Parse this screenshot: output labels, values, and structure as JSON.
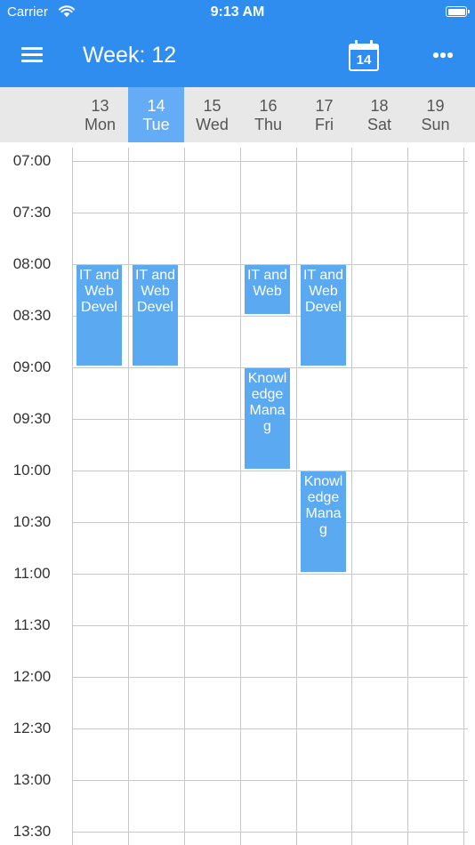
{
  "status_bar": {
    "carrier": "Carrier",
    "time": "9:13 AM"
  },
  "toolbar": {
    "title": "Week: 12",
    "today_day": "14"
  },
  "colors": {
    "primary": "#2f8df0",
    "selected_day": "#64acf6",
    "event": "#5aa9f1",
    "header_bg": "#e8e8e8"
  },
  "icons": {
    "menu": "hamburger-icon",
    "today": "calendar-icon",
    "more": "more-horizontal-icon",
    "wifi": "wifi-icon",
    "battery": "battery-icon"
  },
  "days": [
    {
      "num": "13",
      "name": "Mon",
      "selected": false
    },
    {
      "num": "14",
      "name": "Tue",
      "selected": true
    },
    {
      "num": "15",
      "name": "Wed",
      "selected": false
    },
    {
      "num": "16",
      "name": "Thu",
      "selected": false
    },
    {
      "num": "17",
      "name": "Fri",
      "selected": false
    },
    {
      "num": "18",
      "name": "Sat",
      "selected": false
    },
    {
      "num": "19",
      "name": "Sun",
      "selected": false
    }
  ],
  "times": [
    "07:00",
    "07:30",
    "08:00",
    "08:30",
    "09:00",
    "09:30",
    "10:00",
    "10:30",
    "11:00",
    "11:30",
    "12:00",
    "12:30",
    "13:00",
    "13:30"
  ],
  "events": [
    {
      "title": "IT and Web Devel",
      "day": 0,
      "start": "08:00",
      "end": "09:00"
    },
    {
      "title": "IT and Web Devel",
      "day": 1,
      "start": "08:00",
      "end": "09:00"
    },
    {
      "title": "IT and Web",
      "day": 3,
      "start": "08:00",
      "end": "08:30"
    },
    {
      "title": "IT and Web Devel",
      "day": 4,
      "start": "08:00",
      "end": "09:00"
    },
    {
      "title": "Knowledge Manag",
      "day": 3,
      "start": "09:00",
      "end": "10:00"
    },
    {
      "title": "Knowledge Manag",
      "day": 4,
      "start": "10:00",
      "end": "11:00"
    }
  ]
}
